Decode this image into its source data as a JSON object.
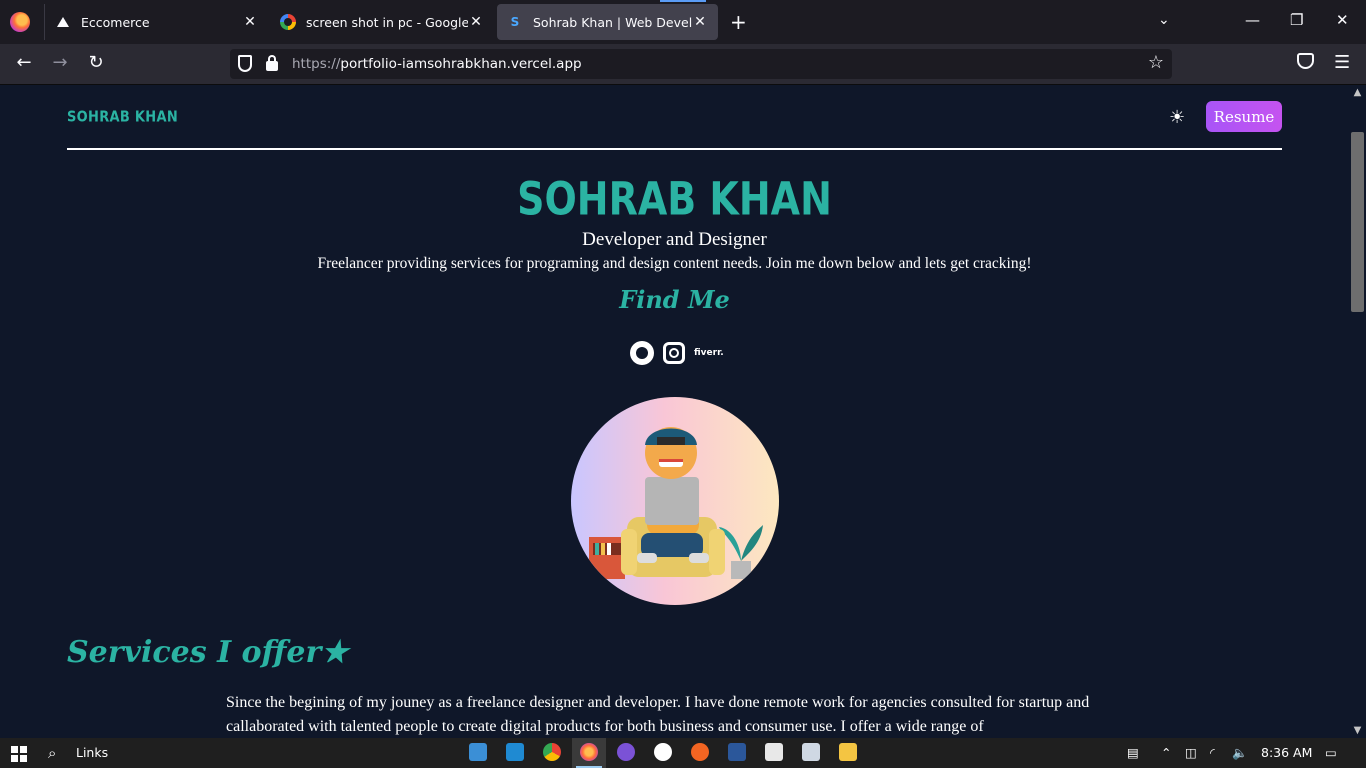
{
  "browser": {
    "tabs": [
      {
        "title": "Eccomerce",
        "close": "✕"
      },
      {
        "title": "screen shot in pc - Google Search",
        "close": "✕"
      },
      {
        "title": "Sohrab Khan | Web Developer",
        "close": "✕"
      }
    ],
    "new_tab": "+",
    "url_protocol": "https://",
    "url_host": "portfolio-iamsohrabkhan.vercel.app"
  },
  "site": {
    "brand": "SOHRAB KHAN",
    "resume_label": "Resume",
    "theme_toggle": "☀",
    "hero": {
      "name": "SOHRAB KHAN",
      "role": "Developer and Designer",
      "description": "Freelancer providing services for programing and design content needs. Join me down below and lets get cracking!",
      "find_me": "Find Me"
    },
    "socials": {
      "fiverr": "fiverr."
    },
    "services_title": "Services I offer★",
    "about_text": "Since the begining of my jouney as a freelance designer and developer. I have done remote work for agencies consulted for startup and callaborated with talented people to create digital products for both business and consumer use. I offer a wide range of"
  },
  "taskbar": {
    "links_label": "Links",
    "time": "8:36 AM"
  },
  "colors": {
    "accent": "#2bb3a3",
    "button": "#a855f7",
    "background": "#0f1729"
  }
}
